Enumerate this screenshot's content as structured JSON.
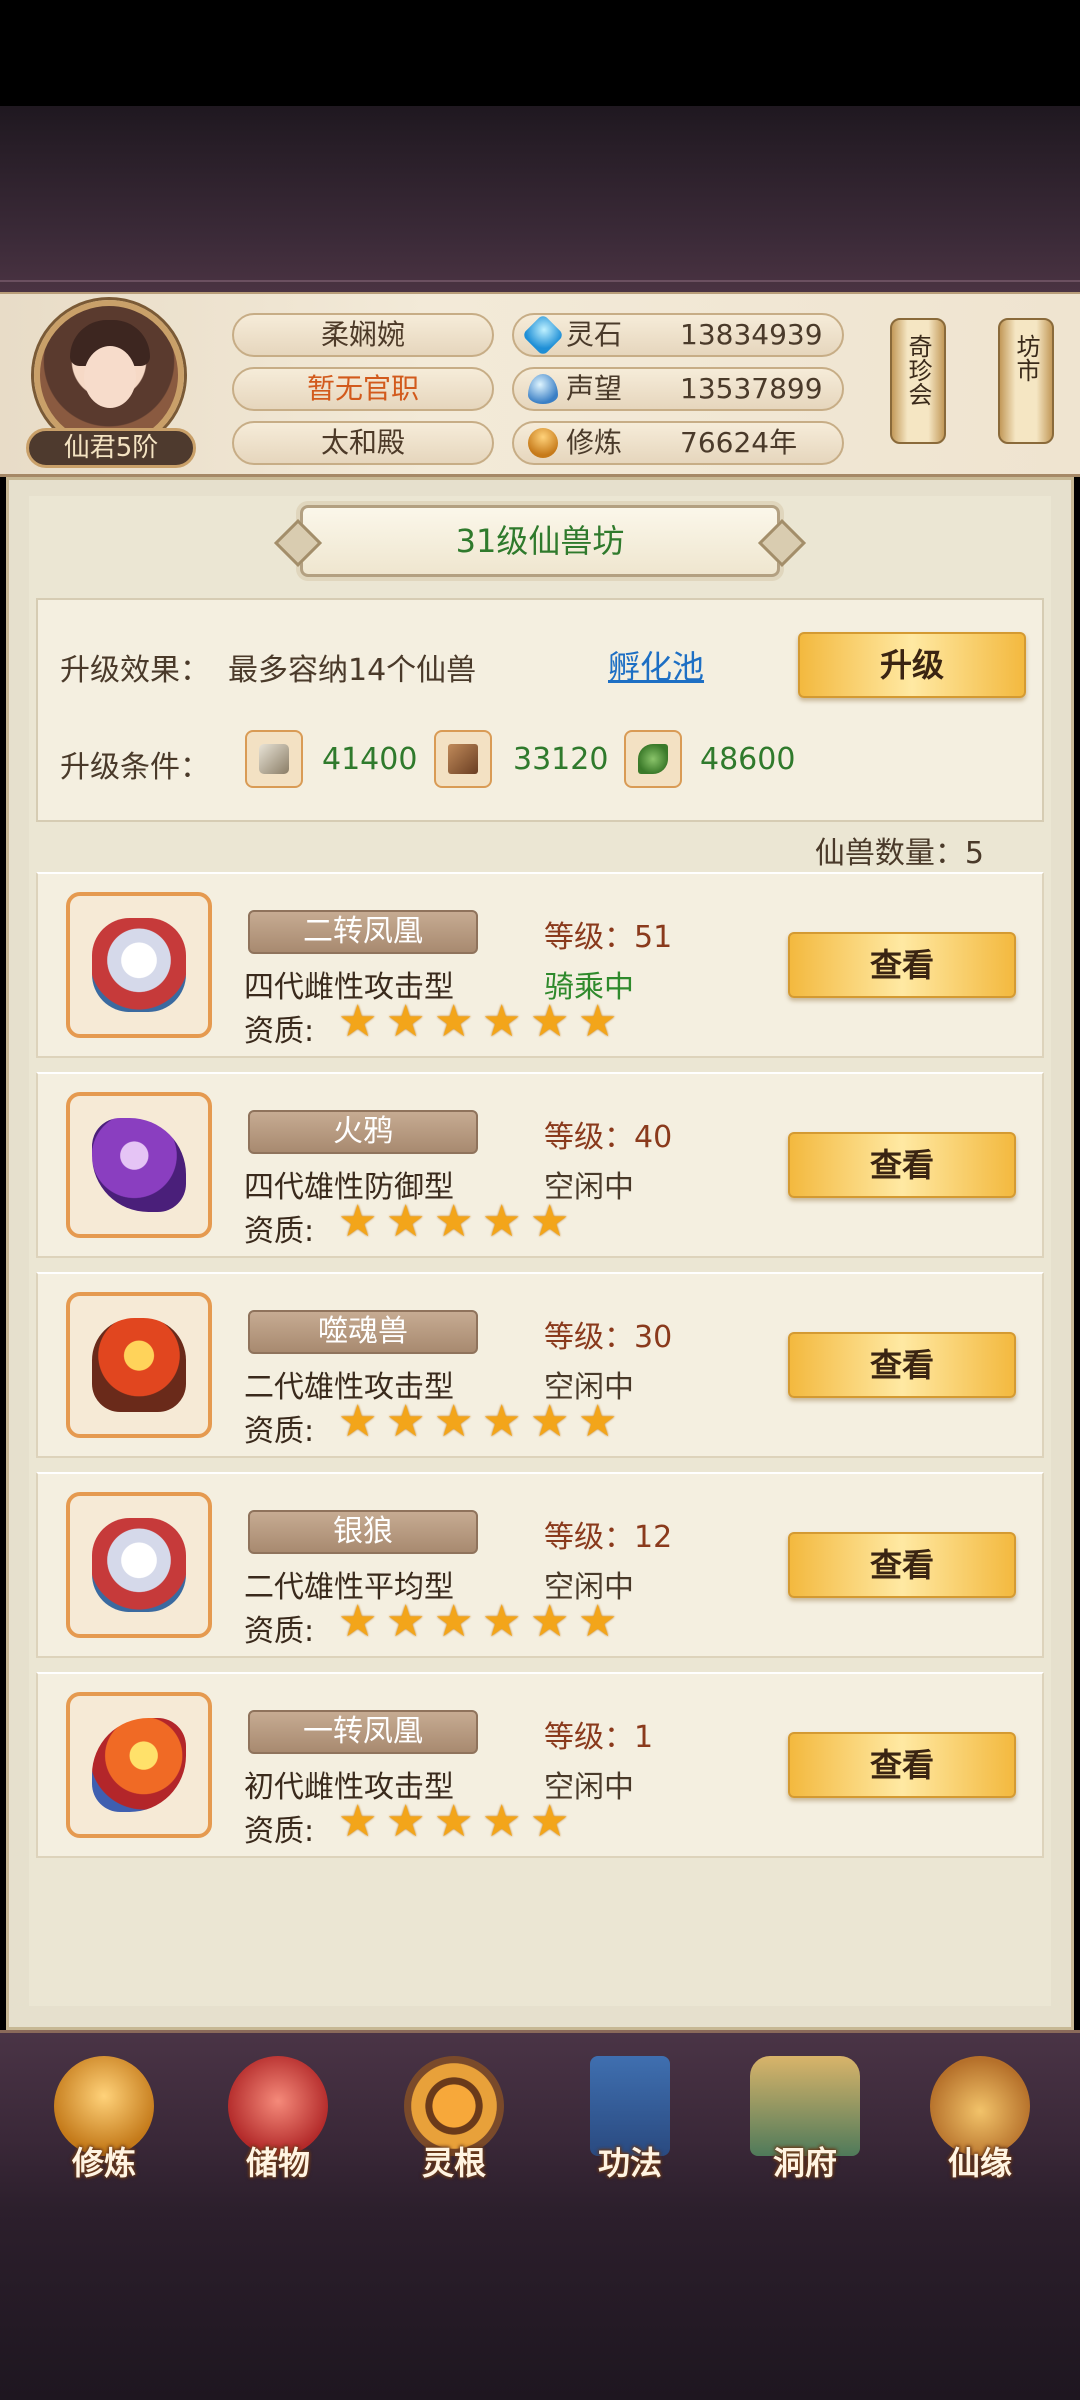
{
  "player": {
    "name": "柔娴婉",
    "official_title": "暂无官职",
    "hall": "太和殿",
    "rank": "仙君5阶"
  },
  "stats": [
    {
      "icon": "spirit-stone-icon",
      "label": "灵石",
      "value": "13834939"
    },
    {
      "icon": "prestige-icon",
      "label": "声望",
      "value": "13537899"
    },
    {
      "icon": "cultivation-icon",
      "label": "修炼",
      "value": "76624年"
    }
  ],
  "side_buttons": {
    "treasure_auction": "奇珍会",
    "market": "坊市"
  },
  "page_title": "31级仙兽坊",
  "upgrade": {
    "effect_label": "升级效果：",
    "effect_text": "最多容纳14个仙兽",
    "link_text": "孵化池",
    "button": "升级",
    "condition_label": "升级条件：",
    "resources": [
      {
        "icon": "ore-icon",
        "value": "41400"
      },
      {
        "icon": "wood-icon",
        "value": "33120"
      },
      {
        "icon": "herb-icon",
        "value": "48600"
      }
    ]
  },
  "beast_count_text": "仙兽数量：5",
  "beasts": [
    {
      "name": "二转凤凰",
      "type": "四代雌性攻击型",
      "level": "等级：51",
      "status": "骑乘中",
      "aptitude_label": "资质:",
      "stars": 6,
      "portrait": "wolf",
      "view": "查看"
    },
    {
      "name": "火鸦",
      "type": "四代雄性防御型",
      "level": "等级：40",
      "status": "空闲中",
      "aptitude_label": "资质:",
      "stars": 5,
      "portrait": "crow",
      "view": "查看"
    },
    {
      "name": "噬魂兽",
      "type": "二代雄性攻击型",
      "level": "等级：30",
      "status": "空闲中",
      "aptitude_label": "资质:",
      "stars": 6,
      "portrait": "soul",
      "view": "查看"
    },
    {
      "name": "银狼",
      "type": "二代雄性平均型",
      "level": "等级：12",
      "status": "空闲中",
      "aptitude_label": "资质:",
      "stars": 6,
      "portrait": "wolf",
      "view": "查看"
    },
    {
      "name": "一转凤凰",
      "type": "初代雌性攻击型",
      "level": "等级：1",
      "status": "空闲中",
      "aptitude_label": "资质:",
      "stars": 5,
      "portrait": "phoenix",
      "view": "查看"
    }
  ],
  "nav": [
    {
      "label": "修炼",
      "icon": "cultivate-icon"
    },
    {
      "label": "储物",
      "icon": "storage-bag-icon"
    },
    {
      "label": "灵根",
      "icon": "spirit-root-icon"
    },
    {
      "label": "功法",
      "icon": "skill-book-icon"
    },
    {
      "label": "洞府",
      "icon": "cave-mansion-icon"
    },
    {
      "label": "仙缘",
      "icon": "immortal-fate-icon"
    }
  ]
}
